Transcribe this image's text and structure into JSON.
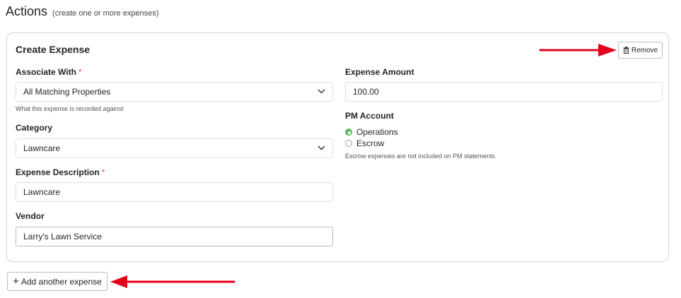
{
  "header": {
    "title": "Actions",
    "subtitle": "(create one or more expenses)"
  },
  "expense_card": {
    "title": "Create Expense",
    "remove_label": "Remove",
    "associate_with": {
      "label": "Associate With",
      "required_mark": "*",
      "value": "All Matching Properties",
      "help": "What this expense is recorded against"
    },
    "category": {
      "label": "Category",
      "value": "Lawncare"
    },
    "description": {
      "label": "Expense Description",
      "required_mark": "*",
      "value": "Lawncare"
    },
    "vendor": {
      "label": "Vendor",
      "value": "Larry's Lawn Service"
    },
    "amount": {
      "label": "Expense Amount",
      "value": "100.00"
    },
    "pm_account": {
      "label": "PM Account",
      "options": [
        {
          "label": "Operations",
          "checked": true
        },
        {
          "label": "Escrow",
          "checked": false
        }
      ],
      "help": "Escrow expenses are not included on PM statements"
    }
  },
  "add_expense_label": "Add another expense",
  "colors": {
    "annotation_arrow": "#e3001b",
    "radio_checked": "#5cb85c",
    "required": "#d9534f"
  },
  "icons": [
    "trash-icon",
    "plus-icon",
    "chevron-down-icon",
    "red-arrow-annotation"
  ]
}
